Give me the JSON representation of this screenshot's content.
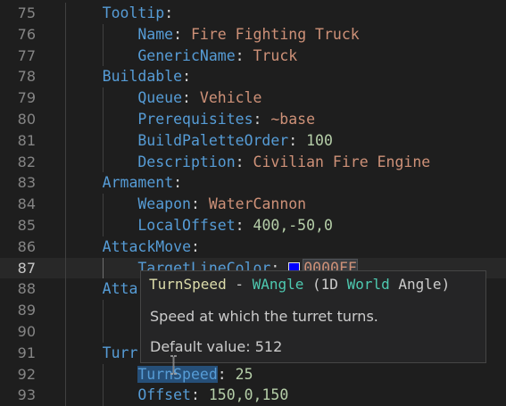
{
  "lines": [
    {
      "num": "75",
      "indent": 1,
      "key": "Tooltip",
      "value": "",
      "vclass": ""
    },
    {
      "num": "76",
      "indent": 2,
      "key": "Name",
      "value": "Fire Fighting Truck",
      "vclass": "str"
    },
    {
      "num": "77",
      "indent": 2,
      "key": "GenericName",
      "value": "Truck",
      "vclass": "str"
    },
    {
      "num": "78",
      "indent": 1,
      "key": "Buildable",
      "value": "",
      "vclass": ""
    },
    {
      "num": "79",
      "indent": 2,
      "key": "Queue",
      "value": "Vehicle",
      "vclass": "str"
    },
    {
      "num": "80",
      "indent": 2,
      "key": "Prerequisites",
      "value": "~base",
      "vclass": "str"
    },
    {
      "num": "81",
      "indent": 2,
      "key": "BuildPaletteOrder",
      "value": "100",
      "vclass": "num"
    },
    {
      "num": "82",
      "indent": 2,
      "key": "Description",
      "value": "Civilian Fire Engine",
      "vclass": "str"
    },
    {
      "num": "83",
      "indent": 1,
      "key": "Armament",
      "value": "",
      "vclass": ""
    },
    {
      "num": "84",
      "indent": 2,
      "key": "Weapon",
      "value": "WaterCannon",
      "vclass": "str"
    },
    {
      "num": "85",
      "indent": 2,
      "key": "LocalOffset",
      "value": "400,-50,0",
      "vclass": "num"
    },
    {
      "num": "86",
      "indent": 1,
      "key": "AttackMove",
      "value": "",
      "vclass": ""
    },
    {
      "num": "87",
      "indent": 2,
      "key": "TargetLineColor",
      "value": "0000FF",
      "vclass": "color",
      "swatch": "#0000ff",
      "current": true
    },
    {
      "num": "88",
      "indent": 1,
      "key": "Atta",
      "value": "",
      "vclass": "",
      "nocolon": true
    },
    {
      "num": "89",
      "indent": 0,
      "key": "",
      "value": "",
      "vclass": ""
    },
    {
      "num": "90",
      "indent": 0,
      "key": "",
      "value": "",
      "vclass": ""
    },
    {
      "num": "91",
      "indent": 1,
      "key": "Turr",
      "value": "",
      "vclass": "",
      "nocolon": true
    },
    {
      "num": "92",
      "indent": 2,
      "key": "TurnSpeed",
      "value": "25",
      "vclass": "num",
      "wordhl": true
    },
    {
      "num": "93",
      "indent": 2,
      "key": "Offset",
      "value": "150,0,150",
      "vclass": "num"
    }
  ],
  "hover": {
    "name": "TurnSpeed",
    "sep": " - ",
    "type": "WAngle",
    "open": " (",
    "dim": "1D",
    "sp1": " ",
    "world": "World",
    "sp2": " ",
    "angle": "Angle",
    "close": ")",
    "description": "Speed at which the turret turns.",
    "default_value": "Default value: 512"
  },
  "colors": {
    "background": "#1e1e1e",
    "key": "#569cd6",
    "string": "#ce9178",
    "number": "#b5cea8",
    "swatch": "#0000ff"
  }
}
